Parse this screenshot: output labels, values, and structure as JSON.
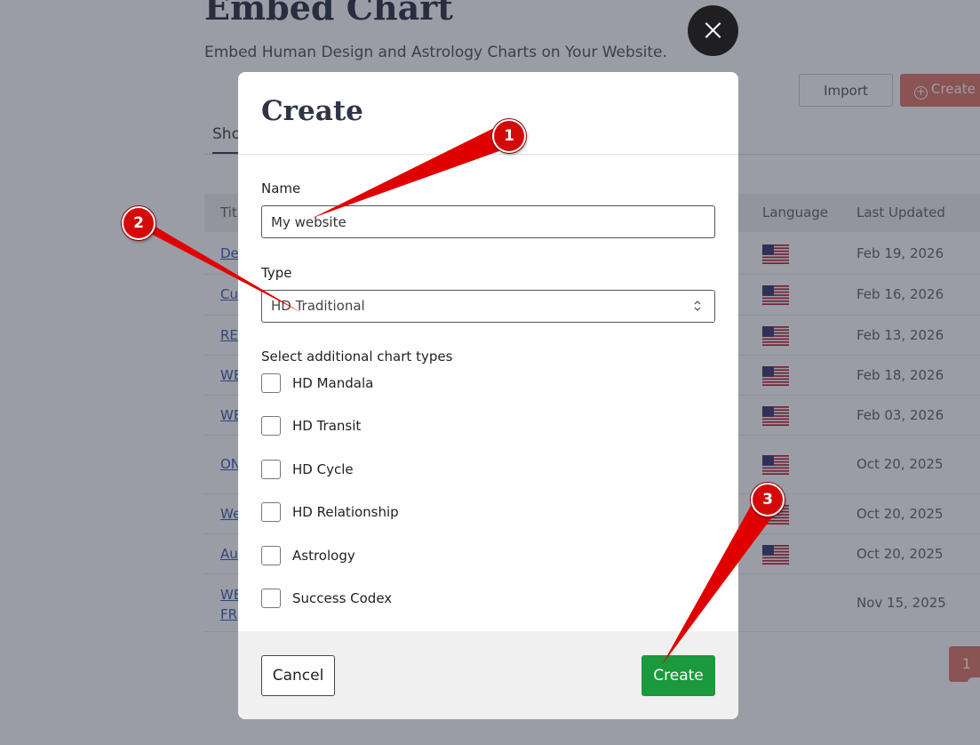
{
  "background": {
    "page_title": "Embed Chart",
    "page_subtitle": "Embed Human Design and Astrology Charts on Your Website.",
    "import_label": "Import",
    "create_new_label": "Create n",
    "active_tab": "Sho",
    "table": {
      "headers": {
        "title": "Titl",
        "language": "Language",
        "last_updated": "Last Updated"
      },
      "rows": [
        {
          "title": "De",
          "date": "Feb 19, 2026",
          "flag": true
        },
        {
          "title": "Cu",
          "date": "Feb 16, 2026",
          "flag": true
        },
        {
          "title": "RE",
          "date": "Feb 13, 2026",
          "flag": true
        },
        {
          "title": "WE",
          "date": "Feb 18, 2026",
          "flag": true
        },
        {
          "title": "WE",
          "date": "Feb 03, 2026",
          "flag": true
        },
        {
          "title": "ON",
          "date": "Oct 20, 2025",
          "flag": true
        },
        {
          "title": "We",
          "date": "Oct 20, 2025",
          "flag": true
        },
        {
          "title": "Au",
          "date": "Oct 20, 2025",
          "flag": true
        },
        {
          "title": "WE FR",
          "date": "Nov 15, 2025",
          "flag": false
        }
      ]
    },
    "pager_current": "1"
  },
  "modal": {
    "title": "Create",
    "name_label": "Name",
    "name_value": "My website",
    "type_label": "Type",
    "type_value": "HD Traditional",
    "additional_label": "Select additional chart types",
    "chart_types": [
      "HD Mandala",
      "HD Transit",
      "HD Cycle",
      "HD Relationship",
      "Astrology",
      "Success Codex"
    ],
    "cancel_label": "Cancel",
    "create_label": "Create"
  },
  "callouts": [
    "1",
    "2",
    "3"
  ],
  "colors": {
    "create_button": "#1a9a3c",
    "callout": "#d40a0a",
    "accent": "#e0786b",
    "overlay": "#22263a"
  }
}
